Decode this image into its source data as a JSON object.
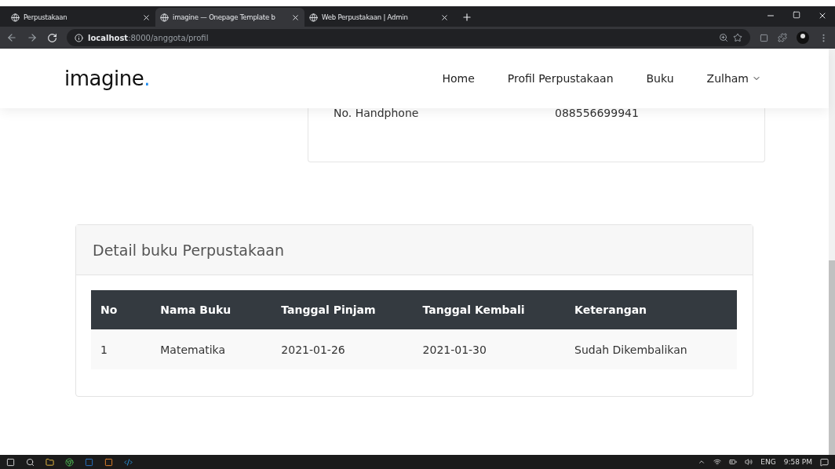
{
  "browser": {
    "tabs": [
      {
        "title": "Perpustakaan",
        "selected": false
      },
      {
        "title": "imagine — Onepage Template b",
        "selected": true
      },
      {
        "title": "Web Perpustakaan | Admin",
        "selected": false
      }
    ],
    "url_host": "localhost",
    "url_path": ":8000/anggota/profil"
  },
  "navbar": {
    "logo": "imagine",
    "logo_dot": ".",
    "items": [
      {
        "label": "Home",
        "kind": "link"
      },
      {
        "label": "Profil Perpustakaan",
        "kind": "link"
      },
      {
        "label": "Buku",
        "kind": "link"
      },
      {
        "label": "Zulham",
        "kind": "dropdown"
      }
    ]
  },
  "profile": {
    "rows": [
      {
        "label": "No. Handphone",
        "value": "088556699941"
      }
    ]
  },
  "detail": {
    "title": "Detail buku Perpustakaan",
    "table": {
      "columns": [
        "No",
        "Nama Buku",
        "Tanggal Pinjam",
        "Tanggal Kembali",
        "Keterangan"
      ],
      "rows": [
        [
          "1",
          "Matematika",
          "2021-01-26",
          "2021-01-30",
          "Sudah Dikembalikan"
        ]
      ]
    }
  },
  "taskbar": {
    "language": "ENG",
    "time": "9:58 PM"
  }
}
